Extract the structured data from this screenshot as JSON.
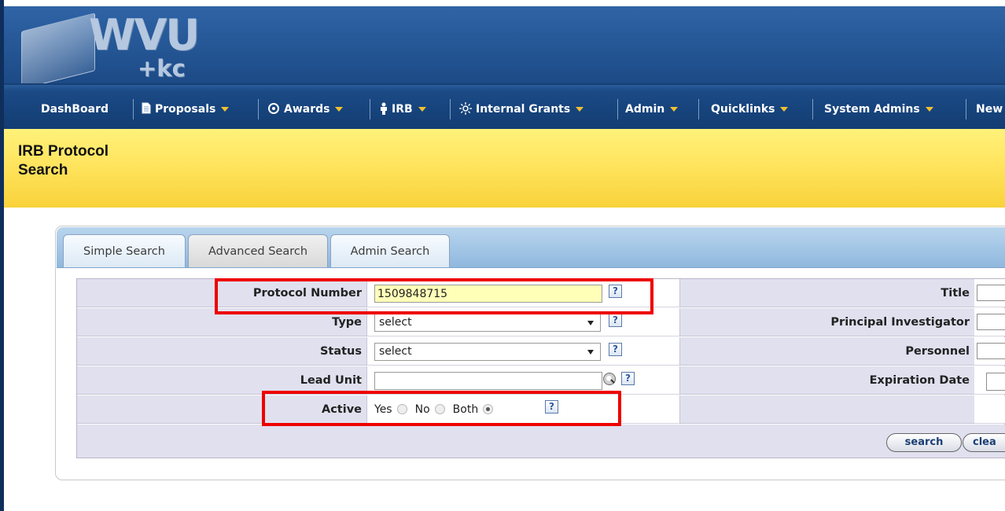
{
  "logo": {
    "wvu": "WVU",
    "kc": "+kc"
  },
  "nav": [
    {
      "label": "DashBoard",
      "icon": "",
      "caret": false
    },
    {
      "label": "Proposals",
      "icon": "document-icon",
      "caret": true
    },
    {
      "label": "Awards",
      "icon": "awards-icon",
      "caret": true
    },
    {
      "label": "IRB",
      "icon": "person-icon",
      "caret": true
    },
    {
      "label": "Internal Grants",
      "icon": "sun-icon",
      "caret": true
    },
    {
      "label": "Admin",
      "icon": "",
      "caret": true
    },
    {
      "label": "Quicklinks",
      "icon": "",
      "caret": true
    },
    {
      "label": "System Admins",
      "icon": "",
      "caret": true
    },
    {
      "label": "New",
      "icon": "",
      "caret": false
    }
  ],
  "page": {
    "title_line1": "IRB Protocol",
    "title_line2": "Search"
  },
  "tabs": {
    "simple": "Simple Search",
    "advanced": "Advanced Search",
    "admin": "Admin Search"
  },
  "form": {
    "protocol_number": {
      "label": "Protocol Number",
      "value": "1509848715"
    },
    "type": {
      "label": "Type",
      "value": "select"
    },
    "status": {
      "label": "Status",
      "value": "select"
    },
    "lead_unit": {
      "label": "Lead Unit",
      "value": ""
    },
    "active": {
      "label": "Active",
      "options": [
        "Yes",
        "No",
        "Both"
      ],
      "selected": "Both"
    },
    "right": {
      "title": "Title",
      "principal_investigator": "Principal Investigator",
      "personnel": "Personnel",
      "expiration_date": "Expiration Date"
    }
  },
  "help_symbol": "?",
  "buttons": {
    "search": "search",
    "clear": "clea"
  },
  "colors": {
    "header": "#1c4a86",
    "nav": "#123c72",
    "titlebar": "#ffe45e",
    "label_bg": "#e0e0ef",
    "highlight_field": "#ffffb8",
    "annotation": "#ee0000",
    "nav_caret": "#f2c02f"
  }
}
